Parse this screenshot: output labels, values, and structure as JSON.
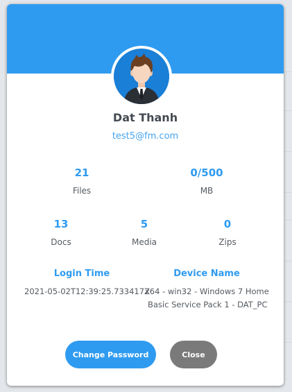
{
  "user": {
    "name": "Dat Thanh",
    "email": "test5@fm.com"
  },
  "stats": {
    "files": {
      "value": "21",
      "label": "Files"
    },
    "storage": {
      "value": "0/500",
      "label": "MB"
    },
    "docs": {
      "value": "13",
      "label": "Docs"
    },
    "media": {
      "value": "5",
      "label": "Media"
    },
    "zips": {
      "value": "0",
      "label": "Zips"
    }
  },
  "info": {
    "login_time_title": "Login Time",
    "login_time_value": "2021-05-02T12:39:25.733417Z",
    "device_name_title": "Device Name",
    "device_name_line1": "x64 - win32 - Windows 7 Home",
    "device_name_line2": "Basic Service Pack 1 - DAT_PC"
  },
  "buttons": {
    "change_password": "Change Password",
    "close": "Close"
  },
  "colors": {
    "accent": "#2f9bf0",
    "secondary_button": "#7a7a7a",
    "text": "#555a60"
  }
}
